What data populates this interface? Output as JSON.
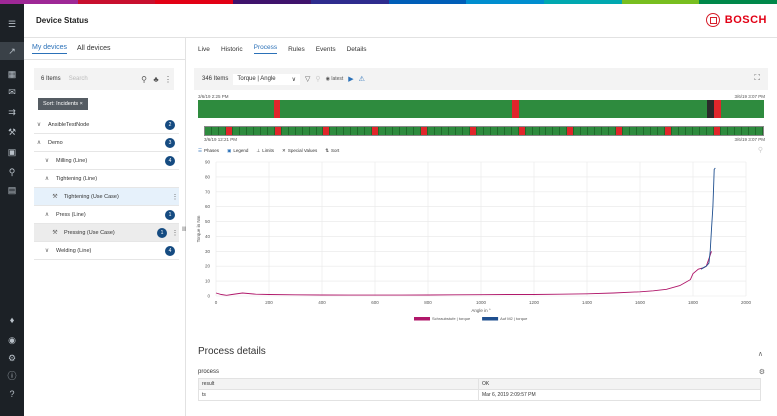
{
  "header": {
    "title": "Device Status",
    "brand": "BOSCH"
  },
  "left_tabs": {
    "my": "My devices",
    "all": "All devices"
  },
  "filter": {
    "count": "6 Items",
    "placeholder": "Search"
  },
  "chip": "Sort: Incidents ×",
  "tree": [
    {
      "label": "AnsibleTestNode",
      "badge": "2",
      "chev": "∨"
    },
    {
      "label": "Demo",
      "badge": "3",
      "chev": "∧"
    },
    {
      "label": "Milling (Line)",
      "badge": "4",
      "chev": "∨"
    },
    {
      "label": "Tightening (Line)",
      "badge": "",
      "chev": "∧"
    },
    {
      "label": "Tightening (Use Case)",
      "badge": "",
      "chev": ""
    },
    {
      "label": "Press (Line)",
      "badge": "1",
      "chev": "∧"
    },
    {
      "label": "Pressing (Use Case)",
      "badge": "1",
      "chev": ""
    },
    {
      "label": "Welding (Line)",
      "badge": "4",
      "chev": "∨"
    }
  ],
  "main_tabs": [
    "Live",
    "Historic",
    "Process",
    "Rules",
    "Events",
    "Details"
  ],
  "toolbar": {
    "items": "346 Items",
    "selection": "Torque | Angle",
    "latest": "latest"
  },
  "timeline": {
    "t_start": "3/6/19 2:25 PM",
    "t_end": "3/6/19 3:07 PM",
    "t_start2": "3/6/19 12:21 PM",
    "t_end2": "3/6/19 3:07 PM"
  },
  "chart_tools": [
    "Phases",
    "Legend",
    "Limits",
    "Special Values",
    "Sort"
  ],
  "chart_data": {
    "type": "line",
    "xlabel": "Angle in °",
    "ylabel": "Torque in Nm",
    "xlim": [
      0,
      2000
    ],
    "ylim": [
      0,
      90
    ],
    "xticks": [
      0,
      200,
      400,
      600,
      800,
      1000,
      1200,
      1400,
      1600,
      1800,
      2000
    ],
    "yticks": [
      0,
      10,
      20,
      30,
      40,
      50,
      60,
      70,
      80,
      90
    ],
    "grid": true,
    "legend_position": "bottom",
    "series": [
      {
        "name": "Schraubstufe | torque",
        "color": "#b0176a",
        "x": [
          0,
          20,
          40,
          60,
          100,
          150,
          200,
          300,
          400,
          500,
          600,
          700,
          800,
          900,
          1000,
          1100,
          1200,
          1300,
          1400,
          1500,
          1600,
          1650,
          1700,
          1720,
          1750,
          1770,
          1790,
          1800,
          1820,
          1840,
          1850,
          1860,
          1870
        ],
        "y": [
          2,
          1,
          0.5,
          1,
          2,
          1.2,
          1,
          0.8,
          0.7,
          0.6,
          0.6,
          0.6,
          0.7,
          0.8,
          0.9,
          1,
          1,
          1.2,
          1.5,
          2,
          2.8,
          3.5,
          4.5,
          5.5,
          7,
          9,
          11,
          15,
          18,
          19,
          20,
          25,
          30
        ]
      },
      {
        "name": "Auf M2 | torque",
        "color": "#1f4f8f",
        "x": [
          1830,
          1840,
          1850,
          1860,
          1865,
          1870,
          1875,
          1878,
          1880,
          1884
        ],
        "y": [
          18,
          19,
          20,
          22,
          30,
          45,
          60,
          75,
          85,
          86
        ]
      }
    ]
  },
  "process": {
    "heading": "Process details",
    "sub": "process",
    "rows": [
      {
        "key": "result",
        "value": "OK"
      },
      {
        "key": "ts",
        "value": "Mar 6, 2019 2:09:57 PM"
      }
    ]
  },
  "colors": {
    "accent": "#2b71b8",
    "badge": "#154b81",
    "ok": "#2e8b3e",
    "nok": "#e0262b",
    "brand": "#e20015"
  }
}
